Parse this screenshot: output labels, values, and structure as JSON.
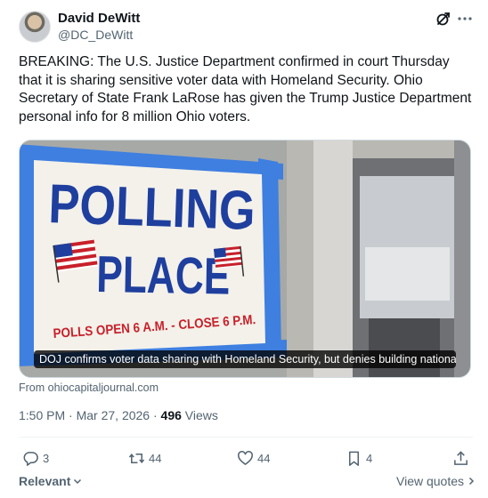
{
  "author": {
    "name": "David DeWitt",
    "handle": "@DC_DeWitt"
  },
  "tweet": {
    "text": "BREAKING: The U.S. Justice Department confirmed in court Thursday that it is sharing sensitive voter data with Homeland Security. Ohio Secretary of State Frank LaRose has given the Trump Justice Department personal info for 8 million Ohio voters."
  },
  "media": {
    "sign_line1": "POLLING",
    "sign_line2": "PLACE",
    "sign_line3": "POLLS OPEN 6 A.M. - CLOSE 6 P.M.",
    "caption": "DOJ confirms voter data sharing with Homeland Security, but denies building national l...",
    "source": "From ohiocapitaljournal.com"
  },
  "meta": {
    "time": "1:50 PM",
    "separator": "·",
    "date": "Mar 27, 2026",
    "views_count": "496",
    "views_label": "Views"
  },
  "actions": {
    "replies": "3",
    "reposts": "44",
    "likes": "44",
    "bookmarks": "4"
  },
  "footer": {
    "sort_label": "Relevant",
    "view_quotes": "View quotes"
  },
  "icons": {
    "grok": "grok-icon",
    "more": "more-icon",
    "reply": "reply-icon",
    "repost": "repost-icon",
    "like": "heart-icon",
    "bookmark": "bookmark-icon",
    "share": "share-icon"
  },
  "colors": {
    "text_primary": "#0f1419",
    "text_secondary": "#536471",
    "sign_blue": "#1f3f9e",
    "tape_blue": "#3e7fe0",
    "sign_red": "#c8202a"
  }
}
